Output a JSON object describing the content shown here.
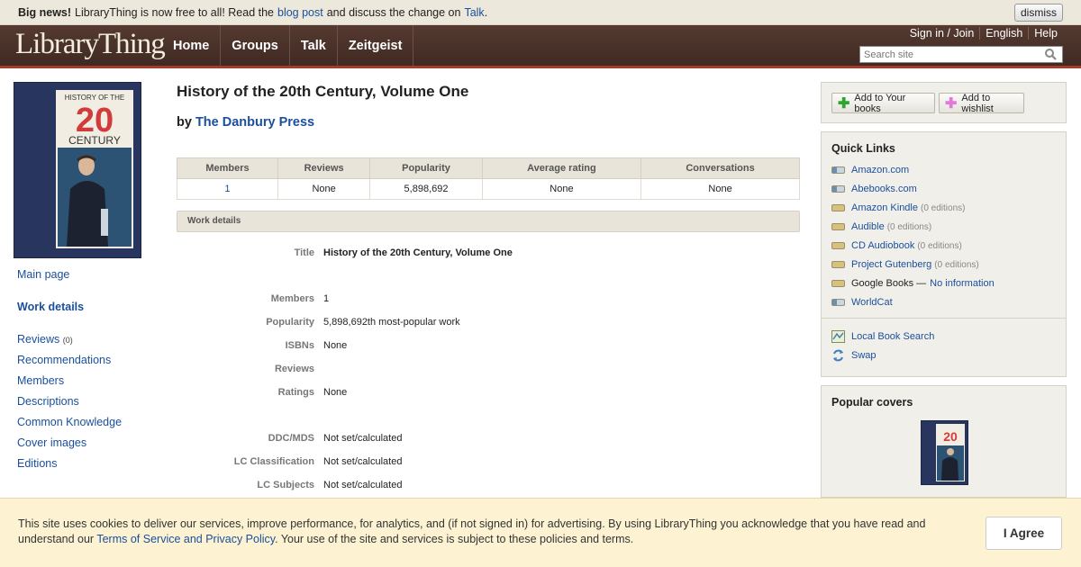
{
  "newsbar": {
    "bold": "Big news!",
    "text1": "LibraryThing is now free to all! Read the",
    "link1": "blog post",
    "text2": "and discuss the change on",
    "link2": "Talk",
    "text3": ".",
    "dismiss": "dismiss"
  },
  "header": {
    "logo": "LibraryThing",
    "nav": [
      "Home",
      "Groups",
      "Talk",
      "Zeitgeist"
    ],
    "toplinks": [
      "Sign in / Join",
      "English",
      "Help"
    ],
    "search_placeholder": "Search site"
  },
  "cover": {
    "line1": "HISTORY OF THE",
    "line2": "20",
    "line3": "CENTURY"
  },
  "leftnav": {
    "main_page": "Main page",
    "work_details": "Work details",
    "reviews": "Reviews",
    "reviews_count": "(0)",
    "recommendations": "Recommendations",
    "members": "Members",
    "descriptions": "Descriptions",
    "common_knowledge": "Common Knowledge",
    "cover_images": "Cover images",
    "editions": "Editions"
  },
  "work": {
    "title": "History of the 20th Century, Volume One",
    "by": "by",
    "author": "The Danbury Press"
  },
  "stats": {
    "headers": [
      "Members",
      "Reviews",
      "Popularity",
      "Average rating",
      "Conversations"
    ],
    "values": [
      "1",
      "None",
      "5,898,692",
      "None",
      "None"
    ]
  },
  "details": {
    "heading": "Work details",
    "rows": [
      {
        "label": "Title",
        "value": "History of the 20th Century, Volume One"
      },
      {
        "label": "Members",
        "value": "1"
      },
      {
        "label": "Popularity",
        "value": "5,898,692th most-popular work"
      },
      {
        "label": "ISBNs",
        "value": "None"
      },
      {
        "label": "Reviews",
        "value": ""
      },
      {
        "label": "Ratings",
        "value": "None"
      },
      {
        "label": "DDC/MDS",
        "value": "Not set/calculated"
      },
      {
        "label": "LC Classification",
        "value": "Not set/calculated"
      },
      {
        "label": "LC Subjects",
        "value": "Not set/calculated"
      }
    ]
  },
  "right": {
    "add_books": "Add to Your books",
    "add_wishlist": "Add to wishlist",
    "quick_links_title": "Quick Links",
    "links": [
      {
        "label": "Amazon.com",
        "editions": ""
      },
      {
        "label": "Abebooks.com",
        "editions": ""
      },
      {
        "label": "Amazon Kindle",
        "editions": "(0 editions)"
      },
      {
        "label": "Audible",
        "editions": "(0 editions)"
      },
      {
        "label": "CD Audiobook",
        "editions": "(0 editions)"
      },
      {
        "label": "Project Gutenberg",
        "editions": "(0 editions)"
      }
    ],
    "google_books": "Google Books —",
    "no_info": "No information",
    "worldcat": "WorldCat",
    "local_search": "Local Book Search",
    "swap": "Swap",
    "popular_covers_title": "Popular covers"
  },
  "cookie": {
    "text1": "This site uses cookies to deliver our services, improve performance, for analytics, and (if not signed in) for advertising. By using LibraryThing you acknowledge that you have read and understand our",
    "link": "Terms of Service and Privacy Policy",
    "text2": ". Your use of the site and services is subject to these policies and terms.",
    "agree": "I Agree"
  },
  "colors": {
    "link": "#1a4f9c",
    "header": "#4a3229",
    "accent": "#a53b2c",
    "cover_blue": "#27355f",
    "cover_red": "#d23b3b"
  }
}
